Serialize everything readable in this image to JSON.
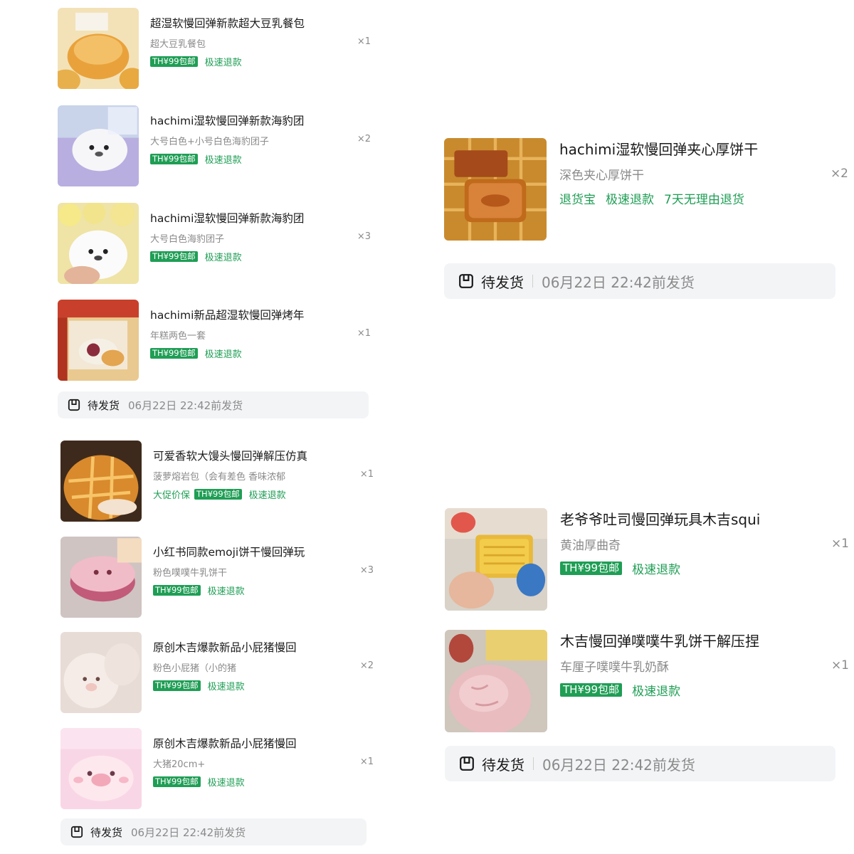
{
  "colors": {
    "accent_green": "#1f9e55",
    "status_bg": "#f3f4f6",
    "muted_text": "#8a8a8a"
  },
  "status_icon": "package-box-icon",
  "groups": [
    {
      "items": [
        {
          "title": "超湿软慢回弹新款超大豆乳餐包",
          "variant": "超大豆乳餐包",
          "qty": "×1",
          "badge": "TH¥99包邮",
          "tags": [
            "极速退款"
          ]
        },
        {
          "title": "hachimi湿软慢回弹新款海豹团",
          "variant": "大号白色+小号白色海豹团子",
          "qty": "×2",
          "badge": "TH¥99包邮",
          "tags": [
            "极速退款"
          ]
        },
        {
          "title": "hachimi湿软慢回弹新款海豹团",
          "variant": "大号白色海豹团子",
          "qty": "×3",
          "badge": "TH¥99包邮",
          "tags": [
            "极速退款"
          ]
        },
        {
          "title": "hachimi新品超湿软慢回弹烤年",
          "variant": "年糕两色一套",
          "qty": "×1",
          "badge": "TH¥99包邮",
          "tags": [
            "极速退款"
          ]
        }
      ],
      "status": {
        "label": "待发货",
        "time": "06月22日 22:42前发货"
      }
    },
    {
      "items": [
        {
          "title": "可爱香软大馒头慢回弹解压仿真",
          "variant": "菠萝熔岩包（会有差色 香味浓郁",
          "qty": "×1",
          "prefix_tag": "大促价保",
          "badge": "TH¥99包邮",
          "tags": [
            "极速退款"
          ]
        },
        {
          "title": "小红书同款emoji饼干慢回弹玩",
          "variant": "粉色噗噗牛乳饼干",
          "qty": "×3",
          "badge": "TH¥99包邮",
          "tags": [
            "极速退款"
          ]
        },
        {
          "title": "原创木吉爆款新品小屁猪慢回",
          "variant": "粉色小屁猪（小的猪",
          "qty": "×2",
          "badge": "TH¥99包邮",
          "tags": [
            "极速退款"
          ]
        },
        {
          "title": "原创木吉爆款新品小屁猪慢回",
          "variant": "大猪20cm+",
          "qty": "×1",
          "badge": "TH¥99包邮",
          "tags": [
            "极速退款"
          ]
        }
      ],
      "status": {
        "label": "待发货",
        "time": "06月22日 22:42前发货"
      }
    },
    {
      "items": [
        {
          "title": "hachimi湿软慢回弹夹心厚饼干",
          "variant": "深色夹心厚饼干",
          "qty": "×2",
          "tags": [
            "退货宝",
            "极速退款",
            "7天无理由退货"
          ]
        }
      ],
      "status": {
        "label": "待发货",
        "time": "06月22日 22:42前发货"
      }
    },
    {
      "items": [
        {
          "title": "老爷爷吐司慢回弹玩具木吉squi",
          "variant": "黄油厚曲奇",
          "qty": "×1",
          "badge": "TH¥99包邮",
          "tags": [
            "极速退款"
          ]
        },
        {
          "title": "木吉慢回弹噗噗牛乳饼干解压捏",
          "variant": "车厘子噗噗牛乳奶酥",
          "qty": "×1",
          "badge": "TH¥99包邮",
          "tags": [
            "极速退款"
          ]
        }
      ],
      "status": {
        "label": "待发货",
        "time": "06月22日 22:42前发货"
      }
    }
  ]
}
